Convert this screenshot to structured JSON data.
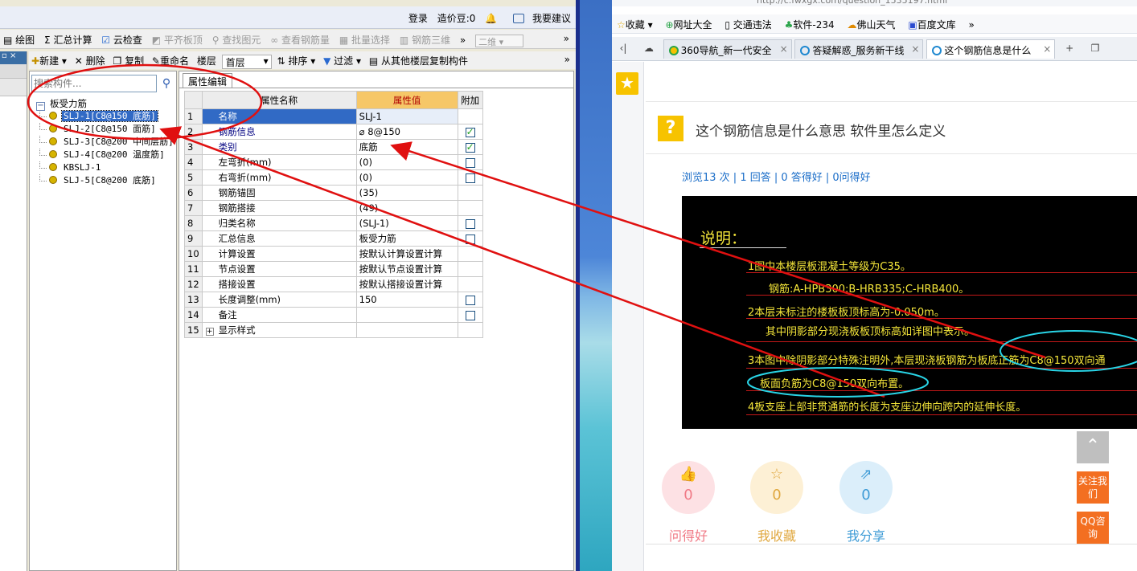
{
  "app": {
    "menubar": [
      "...",
      "...",
      "..."
    ],
    "topbar": {
      "login": "登录",
      "price_label": "造价豆:0",
      "suggest": "我要建议"
    },
    "toolbar1": {
      "draw": "绘图",
      "sum_calc": "汇总计算",
      "cloud_check": "云检查",
      "flat_slab": "平齐板顶",
      "find_elem": "查找图元",
      "view_rebar": "查看钢筋量",
      "batch_select": "批量选择",
      "rebar_3d": "钢筋三维",
      "view_mode": "二维",
      "more": "»"
    },
    "toolbar2": {
      "new": "新建",
      "delete": "删除",
      "copy": "复制",
      "rename": "重命名",
      "floor_label": "楼层",
      "floor_value": "首层",
      "sort": "排序",
      "filter": "过滤",
      "copy_from_floor": "从其他楼层复制构件",
      "more": "»"
    },
    "tree": {
      "search_placeholder": "搜索构件...",
      "root": "板受力筋",
      "items": [
        "SLJ-1[C8@150 底筋]",
        "SLJ-2[C8@150 面筋]",
        "SLJ-3[C8@200 中间层筋]",
        "SLJ-4[C8@200 温度筋]",
        "KBSLJ-1",
        "SLJ-5[C8@200 底筋]"
      ]
    },
    "props": {
      "tab": "属性编辑",
      "headers": {
        "name": "属性名称",
        "value": "属性值",
        "attach": "附加"
      },
      "rows": [
        {
          "num": "1",
          "name": "名称",
          "value": "SLJ-1"
        },
        {
          "num": "2",
          "name": "钢筋信息",
          "value": " 8@150"
        },
        {
          "num": "3",
          "name": "类别",
          "value": "底筋"
        },
        {
          "num": "4",
          "name": "左弯折(mm)",
          "value": "(0)"
        },
        {
          "num": "5",
          "name": "右弯折(mm)",
          "value": "(0)"
        },
        {
          "num": "6",
          "name": "钢筋锚固",
          "value": "(35)"
        },
        {
          "num": "7",
          "name": "钢筋搭接",
          "value": "(49)"
        },
        {
          "num": "8",
          "name": "归类名称",
          "value": "(SLJ-1)"
        },
        {
          "num": "9",
          "name": "汇总信息",
          "value": "板受力筋"
        },
        {
          "num": "10",
          "name": "计算设置",
          "value": "按默认计算设置计算"
        },
        {
          "num": "11",
          "name": "节点设置",
          "value": "按默认节点设置计算"
        },
        {
          "num": "12",
          "name": "搭接设置",
          "value": "按默认搭接设置计算"
        },
        {
          "num": "13",
          "name": "长度调整(mm)",
          "value": "150"
        },
        {
          "num": "14",
          "name": "备注",
          "value": ""
        },
        {
          "num": "15",
          "name": "显示样式",
          "value": ""
        }
      ]
    }
  },
  "browser": {
    "address_fragment": "http://c.fwxgx.com/question_1535197.html",
    "favorites": [
      "收藏",
      "网址大全",
      "交通违法",
      "软件-234",
      "佛山天气",
      "百度文库",
      "»"
    ],
    "tabs": [
      "360导航_新一代安全",
      "答疑解惑_服务新干线",
      "这个钢筋信息是什么"
    ],
    "question_title": "这个钢筋信息是什么意思 软件里怎么定义",
    "stats": "浏览13 次 | 1 回答 | 0 答得好 | 0问得好",
    "image_text": {
      "title": "说明：",
      "line1": "1图中本楼层板混凝土等级为C35。",
      "line2": "钢筋:A-HPB300;B-HRB335;C-HRB400。",
      "line3": "2本层未标注的楼板板顶标高为-0.050m。",
      "line4": "其中阴影部分现浇板板顶标高如详图中表示。",
      "line5": "3本图中除阴影部分特殊注明外,本层现浇板钢筋为板底正筋为C8@150双向通",
      "line6": "板面负筋为C8@150双向布置。",
      "line7": "4板支座上部非贯通筋的长度为支座边伸向跨内的延伸长度。"
    },
    "actions": [
      {
        "label": "问得好",
        "count": "0"
      },
      {
        "label": "我收藏",
        "count": "0"
      },
      {
        "label": "我分享",
        "count": "0"
      }
    ],
    "side_buttons": {
      "follow": "关注我们",
      "qq": "QQ咨询"
    }
  },
  "colors": {
    "annotation_red": "#e01010",
    "annotation_cyan": "#29d4e6",
    "accent_yellow": "#f7c300"
  }
}
